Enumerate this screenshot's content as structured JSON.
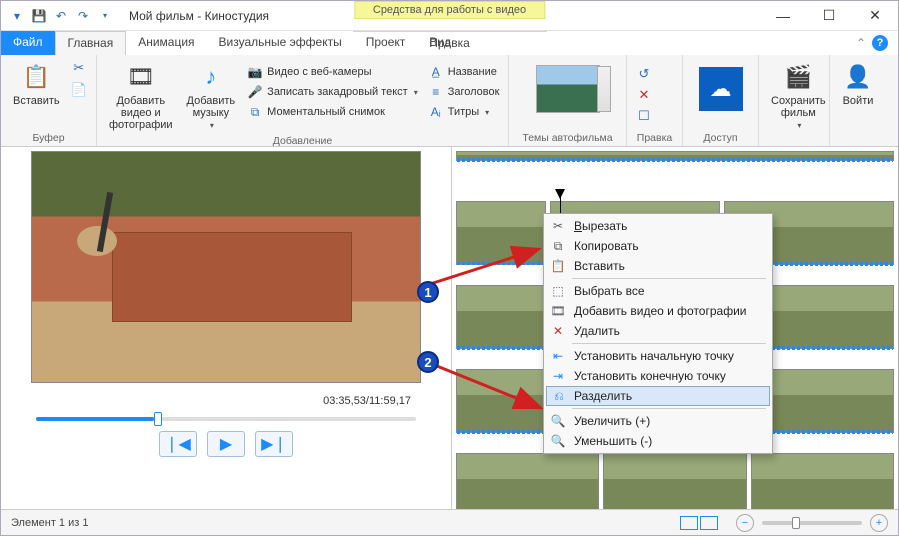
{
  "window": {
    "title": "Мой фильм - Киностудия",
    "videoToolsTab": "Средства для работы с видео",
    "videoToolsSub": "Правка"
  },
  "tabs": {
    "file": "Файл",
    "home": "Главная",
    "animation": "Анимация",
    "visualfx": "Визуальные эффекты",
    "project": "Проект",
    "view": "Вид"
  },
  "ribbon": {
    "buffer": {
      "label": "Буфер",
      "paste": "Вставить"
    },
    "add": {
      "label": "Добавление",
      "addVideoPhoto": "Добавить видео и фотографии",
      "addMusic": "Добавить музыку",
      "webcam": "Видео с веб-камеры",
      "voiceover": "Записать закадровый текст",
      "snapshot": "Моментальный снимок",
      "name": "Название",
      "header": "Заголовок",
      "captions": "Титры"
    },
    "themes": {
      "label": "Темы автофильма"
    },
    "edit": {
      "label": "Правка"
    },
    "access": {
      "label": "Доступ"
    },
    "save": "Сохранить фильм",
    "signin": "Войти"
  },
  "preview": {
    "timecode": "03:35,53/11:59,17"
  },
  "contextMenu": {
    "cut": "Вырезать",
    "copy": "Копировать",
    "paste": "Вставить",
    "selectAll": "Выбрать все",
    "addVideoPhoto": "Добавить видео и фотографии",
    "delete": "Удалить",
    "setStart": "Установить начальную точку",
    "setEnd": "Установить конечную точку",
    "split": "Разделить",
    "zoomIn": "Увеличить (+)",
    "zoomOut": "Уменьшить (-)"
  },
  "annotations": {
    "step1": "1",
    "step2": "2"
  },
  "status": {
    "elements": "Элемент 1 из 1"
  },
  "chart_data": {
    "type": "table",
    "note": "no chart present"
  }
}
